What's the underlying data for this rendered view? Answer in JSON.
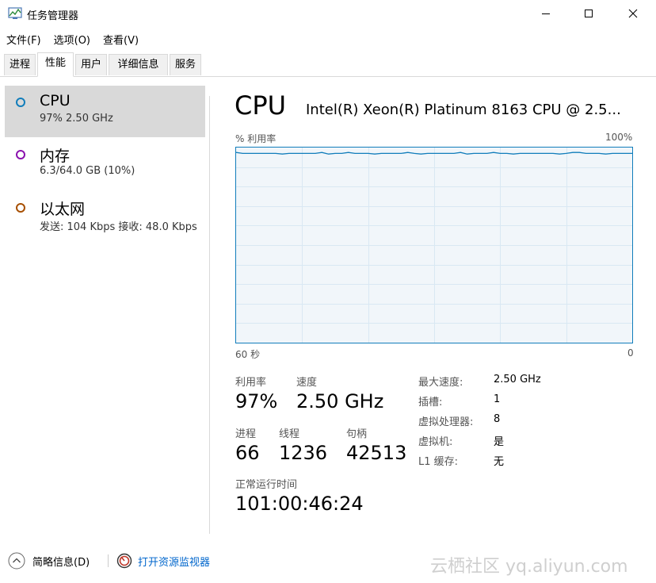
{
  "window": {
    "title": "任务管理器"
  },
  "menu": [
    "文件(F)",
    "选项(O)",
    "查看(V)"
  ],
  "tabs": [
    "进程",
    "性能",
    "用户",
    "详细信息",
    "服务"
  ],
  "sidebar": [
    {
      "title": "CPU",
      "sub": "97%  2.50 GHz",
      "color": "#117dbb"
    },
    {
      "title": "内存",
      "sub": "6.3/64.0 GB (10%)",
      "color": "#8b12ae"
    },
    {
      "title": "以太网",
      "sub": "发送: 104 Kbps  接收: 48.0 Kbps",
      "color": "#a74f01"
    }
  ],
  "main": {
    "title": "CPU",
    "model": "Intel(R) Xeon(R) Platinum 8163 CPU @ 2.5...",
    "graph_label_left": "% 利用率",
    "graph_label_right": "100%",
    "graph_axis_left": "60 秒",
    "graph_axis_right": "0",
    "usage_percent": 97,
    "stats": {
      "util_label": "利用率",
      "util_value": "97%",
      "speed_label": "速度",
      "speed_value": "2.50 GHz",
      "proc_label": "进程",
      "proc_value": "66",
      "thread_label": "线程",
      "thread_value": "1236",
      "handle_label": "句柄",
      "handle_value": "42513",
      "uptime_label": "正常运行时间",
      "uptime_value": "101:00:46:24"
    },
    "details": [
      {
        "label": "最大速度:",
        "value": "2.50 GHz"
      },
      {
        "label": "插槽:",
        "value": "1"
      },
      {
        "label": "虚拟处理器:",
        "value": "8"
      },
      {
        "label": "虚拟机:",
        "value": "是"
      },
      {
        "label": "L1 缓存:",
        "value": "无"
      }
    ]
  },
  "footer": {
    "summary_label": "简略信息(D)",
    "monitor_label": "打开资源监视器",
    "link_color": "#0066cc"
  },
  "watermark": "云栖社区 yq.aliyun.com"
}
